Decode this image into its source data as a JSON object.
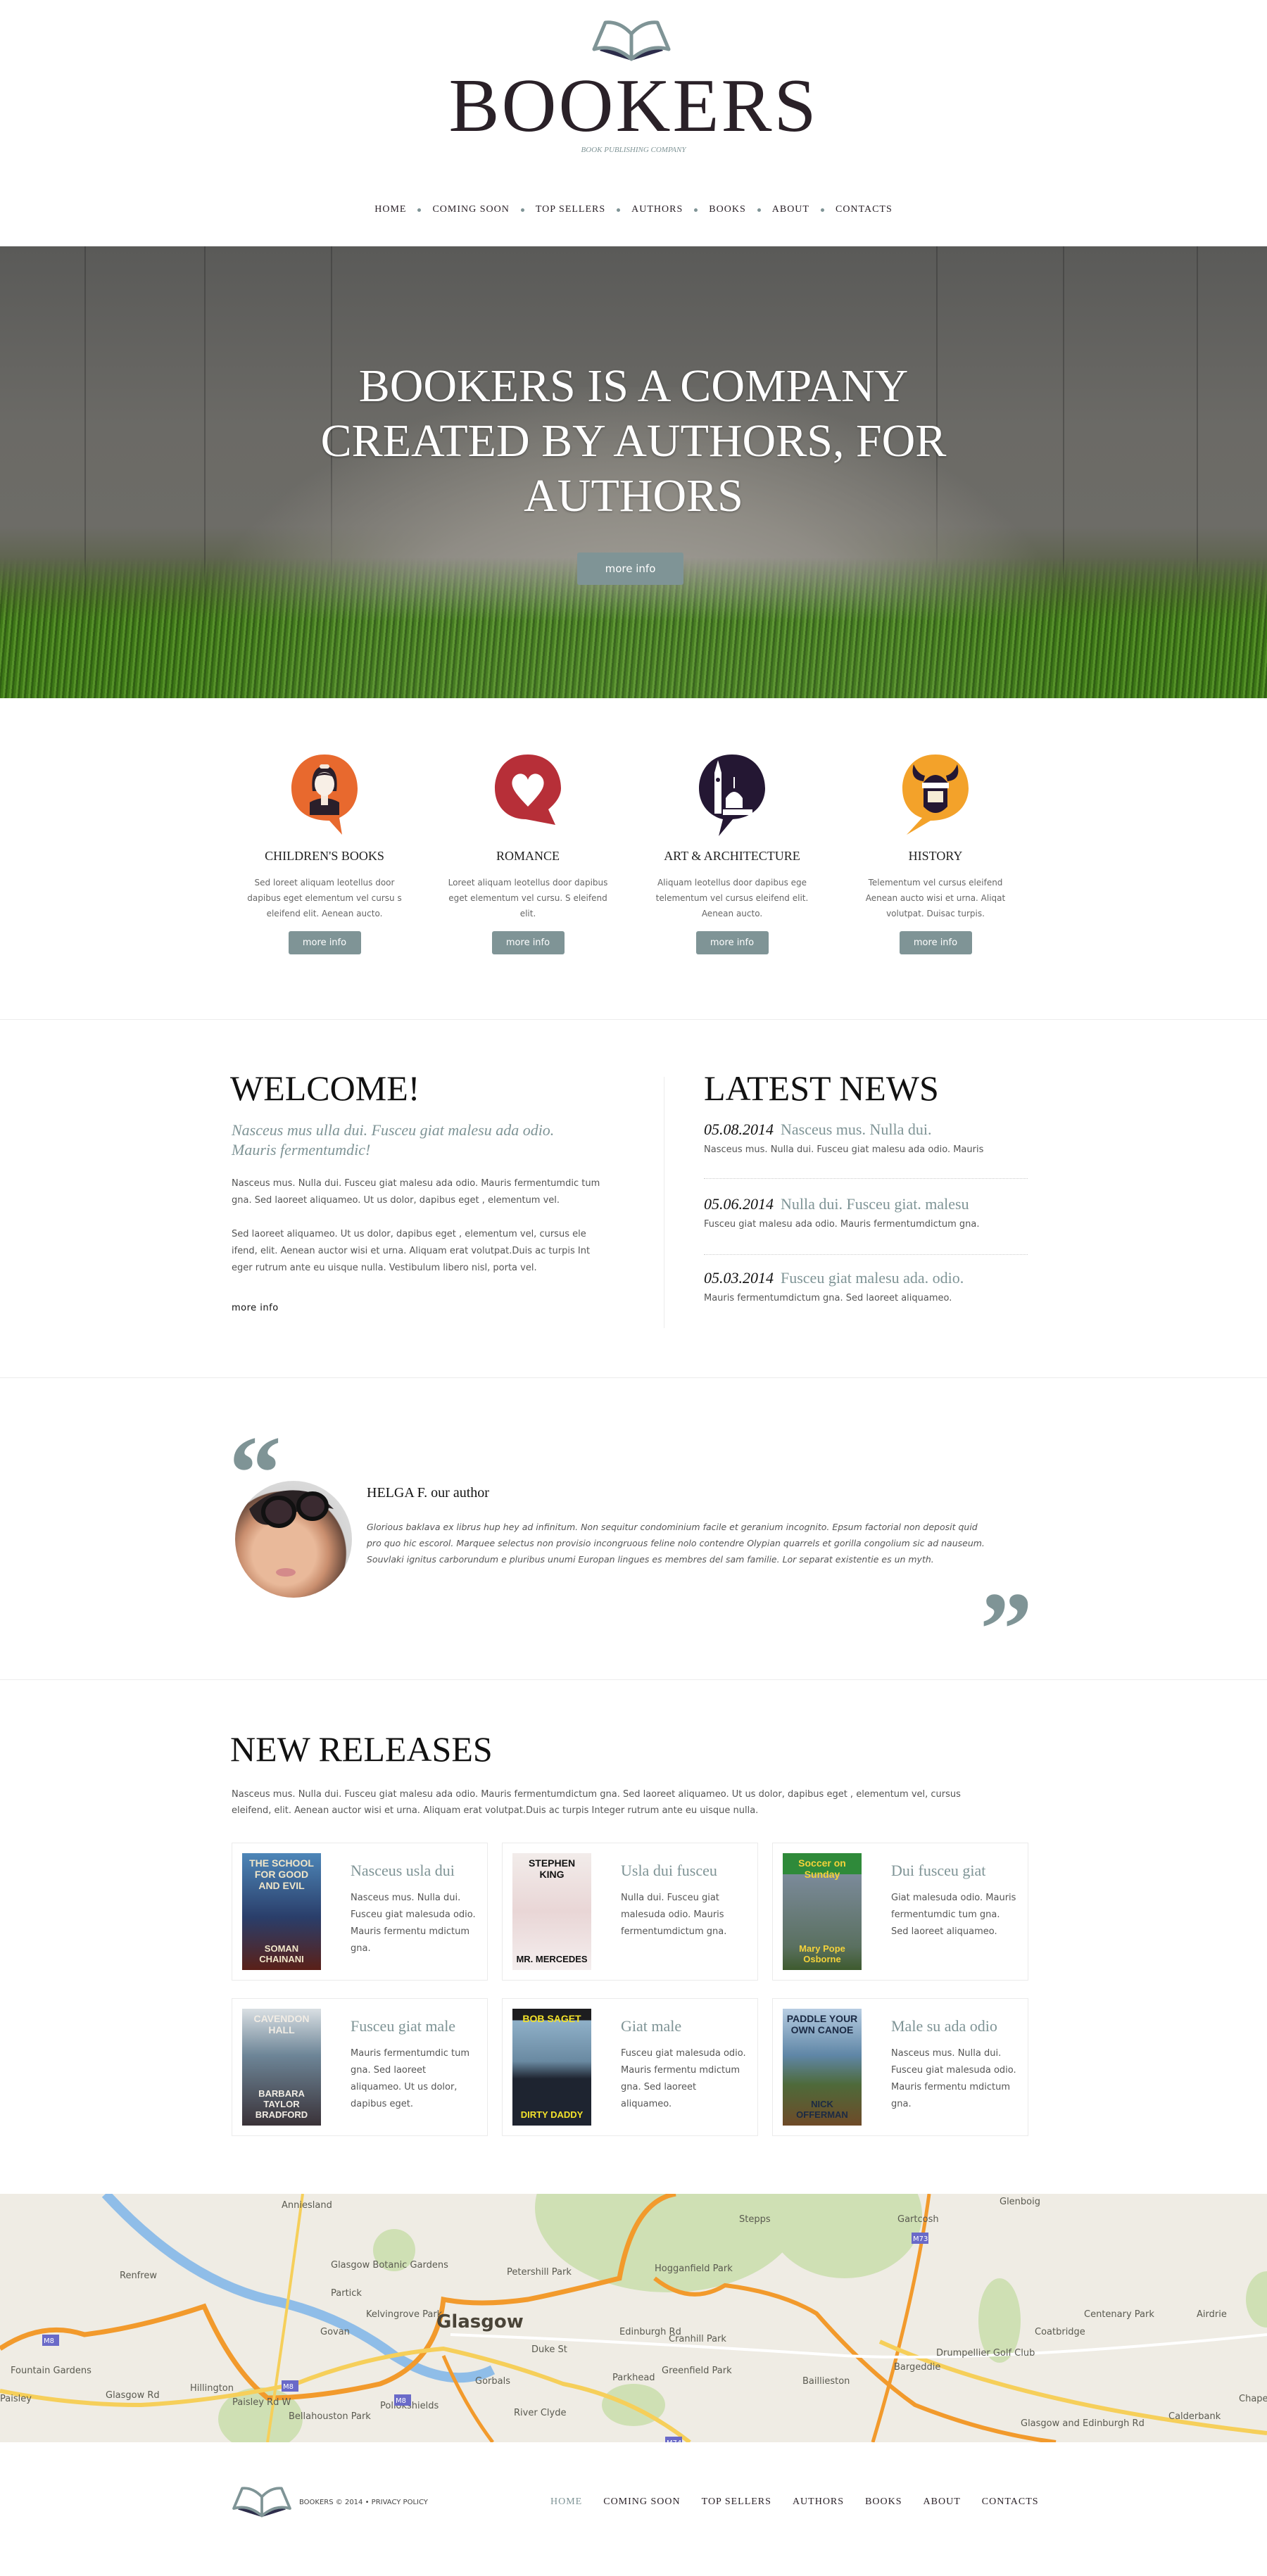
{
  "header": {
    "logo_icon": "open-book-icon",
    "brand": "BOOKERS",
    "tagline": "BOOK PUBLISHING COMPANY",
    "nav": [
      "HOME",
      "COMING SOON",
      "TOP SELLERS",
      "AUTHORS",
      "BOOKS",
      "ABOUT",
      "CONTACTS"
    ]
  },
  "hero": {
    "title_lines": [
      "BOOKERS IS A COMPANY",
      "CREATED BY AUTHORS, FOR",
      "AUTHORS"
    ],
    "button": "more info"
  },
  "colors": {
    "accent": "#7f9496",
    "orange": "#e8692e",
    "red": "#b72f38",
    "dark": "#241733",
    "yellow": "#f3a22a"
  },
  "categories": [
    {
      "icon": "girl-speech-bubble-icon",
      "title": "CHILDREN'S BOOKS",
      "text": "Sed loreet aliquam leotellus door dapibus eget elementum vel cursu s eleifend elit. Aenean aucto.",
      "button": "more info"
    },
    {
      "icon": "heart-speech-bubble-icon",
      "title": "ROMANCE",
      "text": "Loreet aliquam leotellus door dapibus eget elementum vel cursu. S eleifend elit.",
      "button": "more info"
    },
    {
      "icon": "big-ben-speech-bubble-icon",
      "title": "ART & ARCHITECTURE",
      "text": "Aliquam leotellus door dapibus ege telementum vel cursus eleifend elit. Aenean aucto.",
      "button": "more info"
    },
    {
      "icon": "viking-speech-bubble-icon",
      "title": "HISTORY",
      "text": "Telementum vel cursus eleifend Aenean aucto wisi et urna. Aliqat volutpat. Duisac turpis.",
      "button": "more info"
    }
  ],
  "welcome": {
    "title": "WELCOME!",
    "subtitle": "Nasceus mus ulla dui. Fusceu giat malesu ada odio. Mauris fermentumdic!",
    "paragraphs": [
      "Nasceus mus. Nulla dui. Fusceu giat malesu ada odio. Mauris fermentumdic tum gna. Sed laoreet aliquameo. Ut us dolor, dapibus eget , elementum vel.",
      "Sed laoreet aliquameo. Ut us dolor, dapibus eget , elementum vel, cursus ele ifend, elit. Aenean auctor wisi et urna. Aliquam erat volutpat.Duis ac turpis Int eger rutrum ante eu uisque nulla.  Vestibulum libero nisl, porta vel."
    ],
    "more": "more info"
  },
  "news": {
    "title": "LATEST NEWS",
    "items": [
      {
        "date": "05.08.2014",
        "title": "Nasceus mus. Nulla dui.",
        "text": "Nasceus mus. Nulla dui. Fusceu giat malesu ada odio. Mauris"
      },
      {
        "date": "05.06.2014",
        "title": "Nulla dui.  Fusceu giat. malesu",
        "text": "Fusceu giat malesu ada odio. Mauris fermentumdictum gna."
      },
      {
        "date": "05.03.2014",
        "title": "Fusceu giat malesu ada. odio.",
        "text": "Mauris fermentumdictum gna.  Sed laoreet aliquameo."
      }
    ]
  },
  "testimonial": {
    "open_quote": "“",
    "close_quote": "”",
    "author": "HELGA F. our author",
    "text": "Glorious baklava ex librus hup hey ad infinitum. Non sequitur condominium facile et geranium incognito. Epsum factorial non deposit quid pro quo hic escorol. Marquee selectus non provisio incongruous feline nolo contendre Olypian quarrels et gorilla congolium sic ad nauseum. Souvlaki ignitus carborundum e pluribus unumi Europan lingues es membres del sam familie. Lor separat existentie es un myth."
  },
  "releases": {
    "title": "NEW RELEASES",
    "intro": "Nasceus mus. Nulla dui.  Fusceu giat malesu ada odio. Mauris fermentumdictum gna.  Sed laoreet aliquameo.  Ut us dolor, dapibus eget , elementum vel, cursus eleifend, elit. Aenean auctor wisi et urna. Aliquam erat volutpat.Duis ac turpis Integer rutrum ante eu uisque nulla.",
    "books": [
      {
        "title": "Nasceus usla dui",
        "text": "Nasceus mus. Nulla dui. Fusceu giat malesuda odio. Mauris fermentu mdictum gna.",
        "cover_top": "THE SCHOOL FOR GOOD AND EVIL",
        "cover_bottom": "SOMAN CHAINANI",
        "cover_bg": "linear-gradient(180deg,#4d86b8,#2a3e6a 55%,#5a2018)",
        "cover_fg": "#f1e6c8"
      },
      {
        "title": "Usla dui fusceu",
        "text": "Nulla dui.  Fusceu giat malesuda odio. Mauris fermentumdictum gna.",
        "cover_top": "STEPHEN KING",
        "cover_bottom": "MR. MERCEDES",
        "cover_bg": "linear-gradient(180deg,#f2ecea,#e9d6d6 50%,#f4eeee)",
        "cover_fg": "#111"
      },
      {
        "title": "Dui fusceu giat",
        "text": "Giat malesuda odio. Mauris fermentumdic tum gna. Sed laoreet aliquameo.",
        "cover_top": "Soccer on Sunday",
        "cover_bottom": "Mary Pope Osborne",
        "cover_bg": "linear-gradient(180deg,#2f8a3a 0 18%,#7b8a9a 18%,#5a7060 80%,#3e5a2e)",
        "cover_fg": "#f4d23a"
      },
      {
        "title": "Fusceu giat male",
        "text": "Mauris fermentumdic tum gna.  Sed laoreet aliquameo.  Ut us dolor, dapibus eget.",
        "cover_top": "CAVENDON HALL",
        "cover_bottom": "BARBARA TAYLOR BRADFORD",
        "cover_bg": "linear-gradient(180deg,#d9dfe3,#6d8597 40%,#3a3238)",
        "cover_fg": "#f1ece4"
      },
      {
        "title": "Giat male",
        "text": "Fusceu giat malesuda odio. Mauris fermentu mdictum gna. Sed laoreet aliquameo.",
        "cover_top": "BOB SAGET",
        "cover_bottom": "DIRTY DADDY",
        "cover_bg": "linear-gradient(180deg,#1d1d1f 0 10%,#8fb0c8 10%,#6a8aa2 45%,#1e2430 60%)",
        "cover_fg": "#f4e32a"
      },
      {
        "title": "Male su ada odio",
        "text": "Nasceus mus. Nulla dui. Fusceu giat malesuda odio. Mauris fermentu mdictum gna.",
        "cover_top": "PADDLE YOUR OWN CANOE",
        "cover_bottom": "NICK OFFERMAN",
        "cover_bg": "linear-gradient(180deg,#b7cde2,#5f86a6 40%,#4e6a3a 65%,#6e4a28)",
        "cover_fg": "#1b2a44"
      }
    ]
  },
  "map": {
    "city": "Glasgow",
    "labels": [
      "Anniesland",
      "Glasgow Botanic Gardens",
      "Petershill Park",
      "Hogganfield Park",
      "Stepps",
      "Gartcosh",
      "Glenboig",
      "Renfrew",
      "Partick",
      "Kelvingrove Park",
      "Govan",
      "Edinburgh Rd",
      "Cranhill Park",
      "Duke St",
      "Greenfield Park",
      "Parkhead",
      "Baillieston",
      "Bargeddie",
      "Coatbridge",
      "Centenary Park",
      "Airdrie",
      "Drumpellier Golf Club",
      "Fountain Gardens",
      "Paisley",
      "Hillington",
      "Glasgow Rd",
      "Paisley Rd W",
      "Bellahouston Park",
      "Pollokshields",
      "Gorbals",
      "River Clyde",
      "Calderbank",
      "Chapelhall",
      "Glasgow and Edinburgh Rd"
    ],
    "road_shields": [
      "M8",
      "M8",
      "M8",
      "M73",
      "M74"
    ]
  },
  "footer": {
    "copyright": "BOOKERS © 2014 • PRIVACY POLICY",
    "nav": [
      "HOME",
      "COMING SOON",
      "TOP SELLERS",
      "AUTHORS",
      "BOOKS",
      "ABOUT",
      "CONTACTS"
    ],
    "active": "HOME"
  }
}
